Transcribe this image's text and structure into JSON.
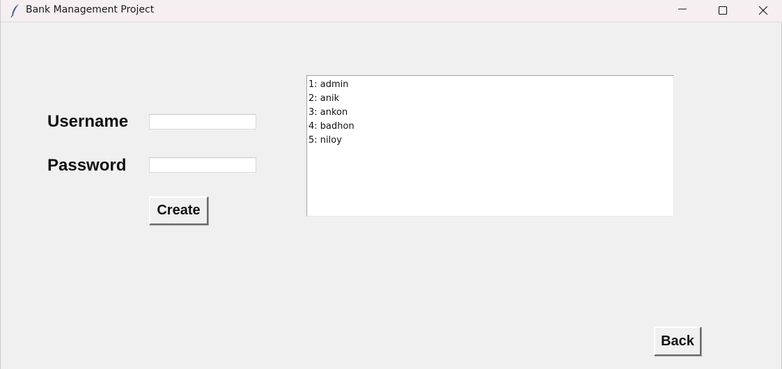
{
  "window": {
    "title": "Bank Management Project"
  },
  "form": {
    "username_label": "Username",
    "username_value": "",
    "password_label": "Password",
    "password_value": "",
    "create_label": "Create"
  },
  "users_list": [
    "1: admin",
    "2: anik",
    "3: ankon",
    "4: badhon",
    "5: niloy"
  ],
  "footer": {
    "back_label": "Back"
  }
}
